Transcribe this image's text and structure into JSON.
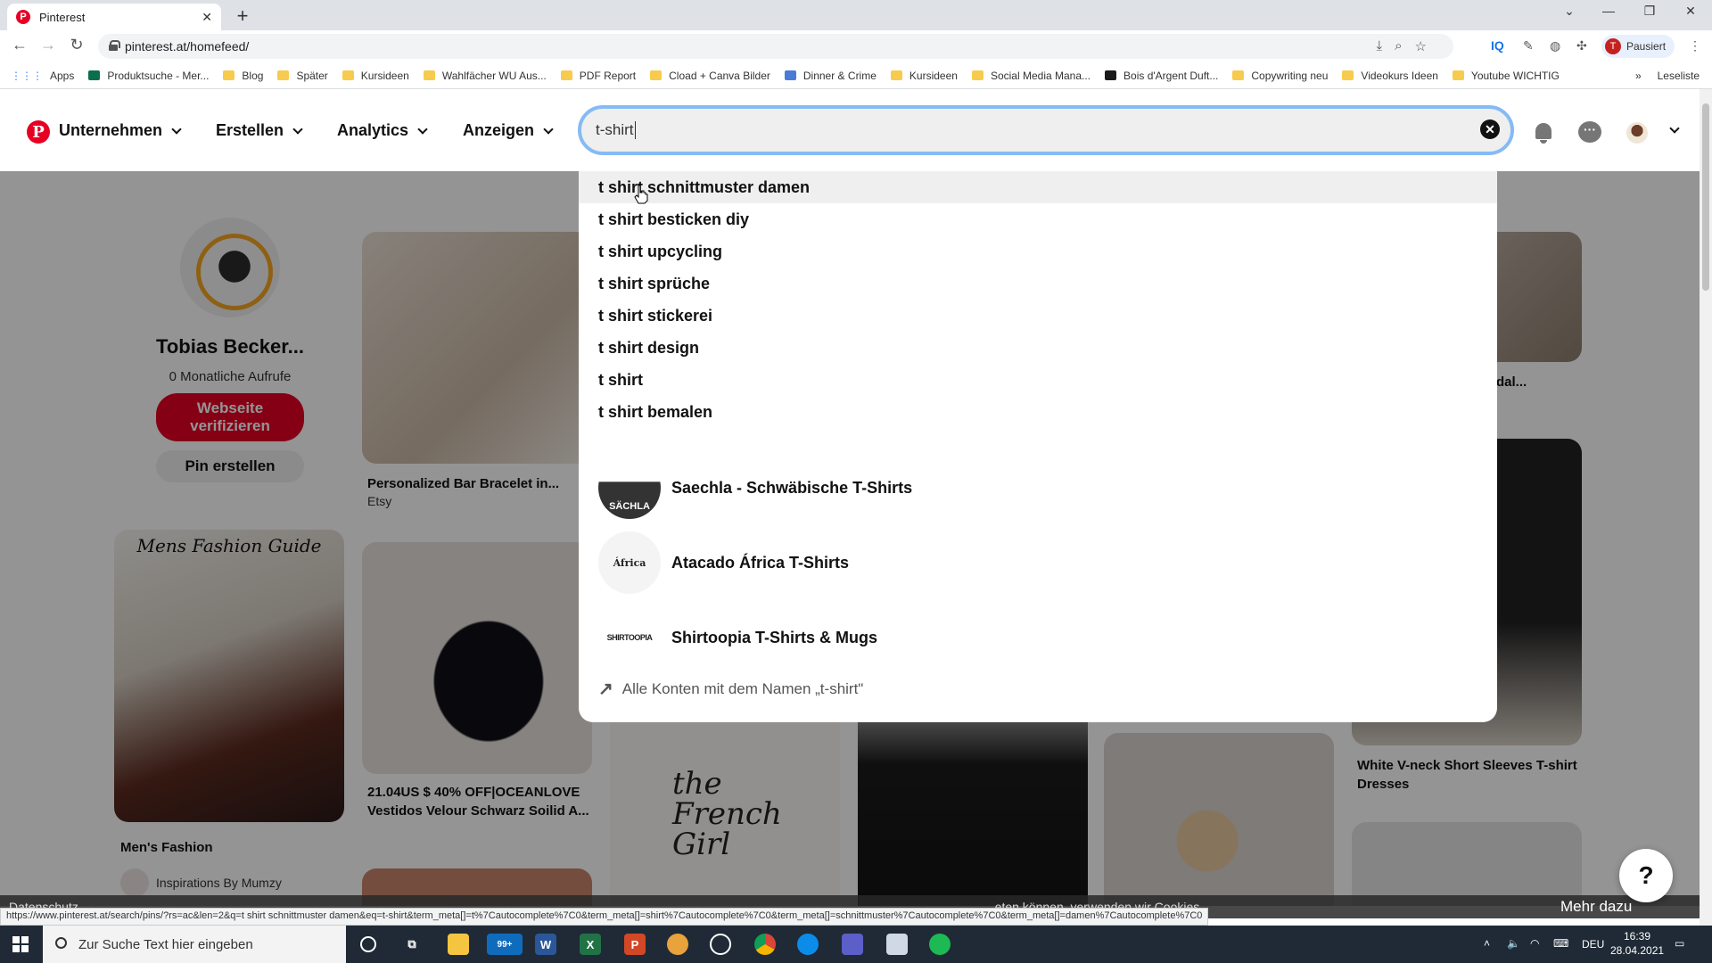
{
  "browser": {
    "tab_title": "Pinterest",
    "url": "pinterest.at/homefeed/",
    "profile_label": "Pausiert",
    "profile_initial": "T",
    "status_url": "https://www.pinterest.at/search/pins/?rs=ac&len=2&q=t shirt schnittmuster damen&eq=t-shirt&term_meta[]=t%7Cautocomplete%7C0&term_meta[]=shirt%7Cautocomplete%7C0&term_meta[]=schnittmuster%7Cautocomplete%7C0&term_meta[]=damen%7Cautocomplete%7C0"
  },
  "bookmarks": {
    "items": [
      {
        "label": "Apps",
        "kind": "apps"
      },
      {
        "label": "Produktsuche - Mer...",
        "kind": "green"
      },
      {
        "label": "Blog",
        "kind": "folder"
      },
      {
        "label": "Später",
        "kind": "folder"
      },
      {
        "label": "Kursideen",
        "kind": "folder"
      },
      {
        "label": "Wahlfächer WU Aus...",
        "kind": "folder"
      },
      {
        "label": "PDF Report",
        "kind": "folder"
      },
      {
        "label": "Cload + Canva Bilder",
        "kind": "folder"
      },
      {
        "label": "Dinner & Crime",
        "kind": "blue"
      },
      {
        "label": "Kursideen",
        "kind": "folder"
      },
      {
        "label": "Social Media Mana...",
        "kind": "folder"
      },
      {
        "label": "Bois d'Argent Duft...",
        "kind": "dark"
      },
      {
        "label": "Copywriting neu",
        "kind": "folder"
      },
      {
        "label": "Videokurs Ideen",
        "kind": "folder"
      },
      {
        "label": "Youtube WICHTIG",
        "kind": "folder"
      }
    ],
    "more": "»",
    "reading_list": "Leseliste"
  },
  "header": {
    "menu": [
      {
        "label": "Unternehmen"
      },
      {
        "label": "Erstellen"
      },
      {
        "label": "Analytics"
      },
      {
        "label": "Anzeigen"
      }
    ],
    "search_value": "t-shirt"
  },
  "profile_card": {
    "name": "Tobias Becker...",
    "views": "0 Monatliche Aufrufe",
    "verify_button": "Webseite verifizieren",
    "pin_button": "Pin erstellen"
  },
  "pins": {
    "bracelet_title": "Personalized Bar Bracelet in...",
    "bracelet_source": "Etsy",
    "dress_title": "21.04US $ 40% OFF|OCEANLOVE Vestidos Velour Schwarz Soilid A...",
    "fashion_title": "Men's Fashion",
    "fashion_source": "Inspirations By Mumzy",
    "fashion_overlay": "Mens Fashion Guide",
    "vneck_title": "White V-neck Short Sleeves T-shirt Dresses",
    "sandal_title": "dal...",
    "french_overlay": "the French Girl"
  },
  "dropdown": {
    "suggestions": [
      "t shirt schnittmuster damen",
      "t shirt besticken diy",
      "t shirt upcycling",
      "t shirt sprüche",
      "t shirt stickerei",
      "t shirt design",
      "t shirt",
      "t shirt bemalen"
    ],
    "accounts": [
      {
        "name": "Saechla - Schwäbische T-Shirts",
        "logo_text": "SÄCHLA"
      },
      {
        "name": "Atacado África T-Shirts",
        "logo_text": "África"
      },
      {
        "name": "Shirtoopia T-Shirts & Mugs",
        "logo_text": "SHIRTOOPIA"
      }
    ],
    "all_accounts": "Alle Konten mit dem Namen „t-shirt\""
  },
  "cookie": {
    "text": "...eten können, verwenden wir Cookies.",
    "more": "Mehr dazu",
    "left_text": "Datenschutz"
  },
  "taskbar": {
    "search_placeholder": "Zur Suche Text hier eingeben",
    "mail_badge": "99+",
    "language": "DEU",
    "time": "16:39",
    "date": "28.04.2021"
  },
  "help_label": "?"
}
